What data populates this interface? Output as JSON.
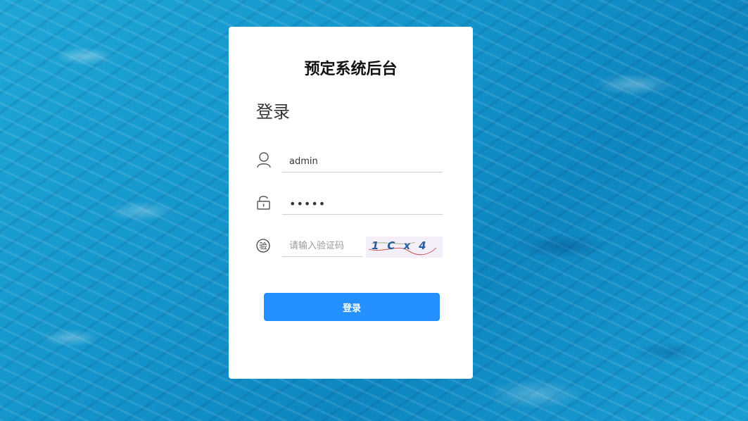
{
  "app": {
    "title": "预定系统后台"
  },
  "form": {
    "heading": "登录",
    "username": {
      "value": "admin",
      "icon": "user-icon"
    },
    "password": {
      "value": "•••••",
      "icon": "unlock-icon"
    },
    "verification": {
      "placeholder": "请输入验证码",
      "icon_char": "验",
      "icon": "verify-icon",
      "captcha_text": "1Cx4"
    },
    "submit_label": "登录"
  },
  "colors": {
    "accent": "#2490ff",
    "card": "#ffffff",
    "water": "#1597cc"
  }
}
